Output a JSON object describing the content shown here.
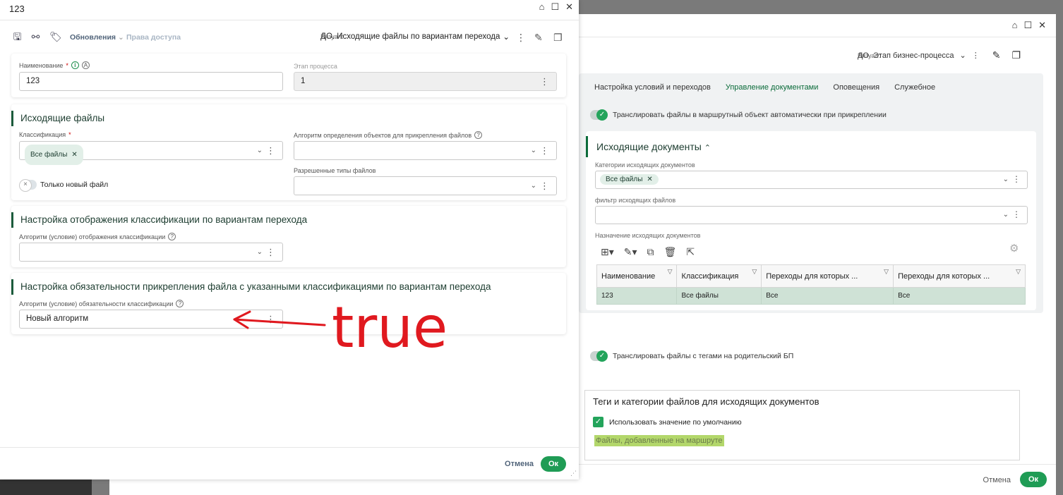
{
  "background": {
    "visual_label": "Визуал:",
    "visual_value": "ДО. Этап бизнес-процесса",
    "tabs": [
      "Настройка условий и переходов",
      "Управление документами",
      "Оповещения",
      "Служебное"
    ],
    "auto_translate_label": "Транслировать файлы в маршрутный объект автоматически при прикреплении",
    "section_title": "Исходящие документы",
    "categories_label": "Категории исходящих документов",
    "categories_chip": "Все файлы",
    "filter_label": "фильтр исходящих файлов",
    "assignment_label": "Назначение исходящих документов",
    "table_headers": [
      "Наименование",
      "Классификация",
      "Переходы для которых ...",
      "Переходы для которых ..."
    ],
    "table_row": [
      "123",
      "Все файлы",
      "Все",
      "Все"
    ],
    "parent_translate_label": "Транслировать файлы с тегами на родительский БП",
    "tags_title": "Теги и категории файлов для исходящих документов",
    "default_value_label": "Использовать значение по умолчанию",
    "highlight_text": "Файлы, добавленные на маршруте",
    "cancel": "Отмена",
    "ok": "Ок"
  },
  "dialog": {
    "title": "123",
    "toolbar": {
      "updates_label": "Обновления",
      "access_label": "Права доступа",
      "visual_label": "Визуал:",
      "visual_value": "ДО. Исходящие файлы по вариантам перехода"
    },
    "name_label": "Наименование",
    "name_value": "123",
    "stage_label": "Этап процесса",
    "stage_value": "1",
    "outgoing": {
      "title": "Исходящие файлы",
      "classification_label": "Классификация",
      "classification_chip": "Все файлы",
      "algorithm_label": "Алгоритм определения объектов для прикрепления файлов",
      "only_new_label": "Только новый файл",
      "allowed_types_label": "Разрешенные типы файлов"
    },
    "display": {
      "title": "Настройка отображения классификации по вариантам перехода",
      "algorithm_label": "Алгоритм (условие) отображения классификации"
    },
    "mandatory": {
      "title": "Настройка обязательности прикрепления файла с указанными классификациями по вариантам перехода",
      "algorithm_label": "Алгоритм (условие) обязательности классификации",
      "algorithm_value": "Новый алгоритм"
    },
    "footer": {
      "cancel": "Отмена",
      "ok": "Ок"
    }
  },
  "annotation": {
    "text": "true",
    "color": "#e0191f"
  },
  "colors": {
    "accent_green": "#1f9c55",
    "dark_green": "#1c5b3c",
    "highlight": "#b3d76b"
  }
}
